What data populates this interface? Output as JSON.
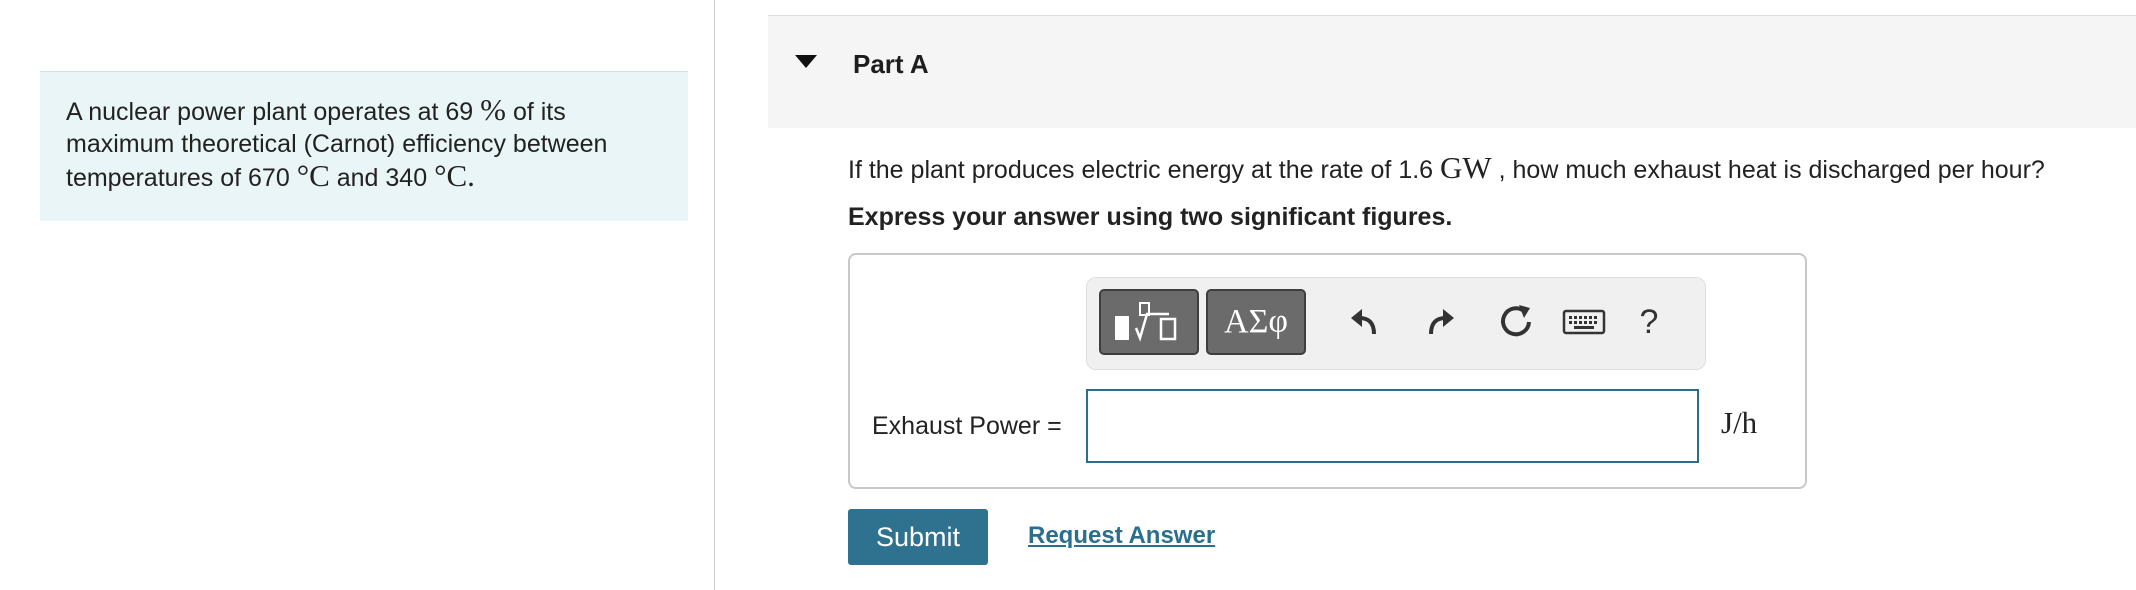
{
  "problem": {
    "line1_pre": "A nuclear power plant operates at 69",
    "line1_unit": "%",
    "line1_post": "of its",
    "line2": "maximum theoretical (Carnot) efficiency between",
    "line3_pre": "temperatures of 670",
    "temp_unit": "°C",
    "line3_mid": "and 340",
    "temp_unit_end": "°C."
  },
  "part": {
    "title": "Part A"
  },
  "question": {
    "pre": "If the plant produces electric energy at the rate of 1.6",
    "unit": "GW",
    "post": ", how much exhaust heat is discharged per hour?",
    "instruction": "Express your answer using two significant figures."
  },
  "toolbar": {
    "symbols_label": "ΑΣφ",
    "help_label": "?",
    "icons": [
      "templates-icon",
      "greek-symbols-icon",
      "undo-icon",
      "redo-icon",
      "reset-icon",
      "keyboard-icon",
      "help-icon"
    ]
  },
  "answer": {
    "label": "Exhaust Power =",
    "value": "",
    "placeholder": "",
    "unit": "J/h"
  },
  "actions": {
    "submit_label": "Submit",
    "request_label": "Request Answer"
  },
  "colors": {
    "problem_bg": "#e9f5f7",
    "accent": "#2f7290",
    "link": "#2a6f8c"
  }
}
